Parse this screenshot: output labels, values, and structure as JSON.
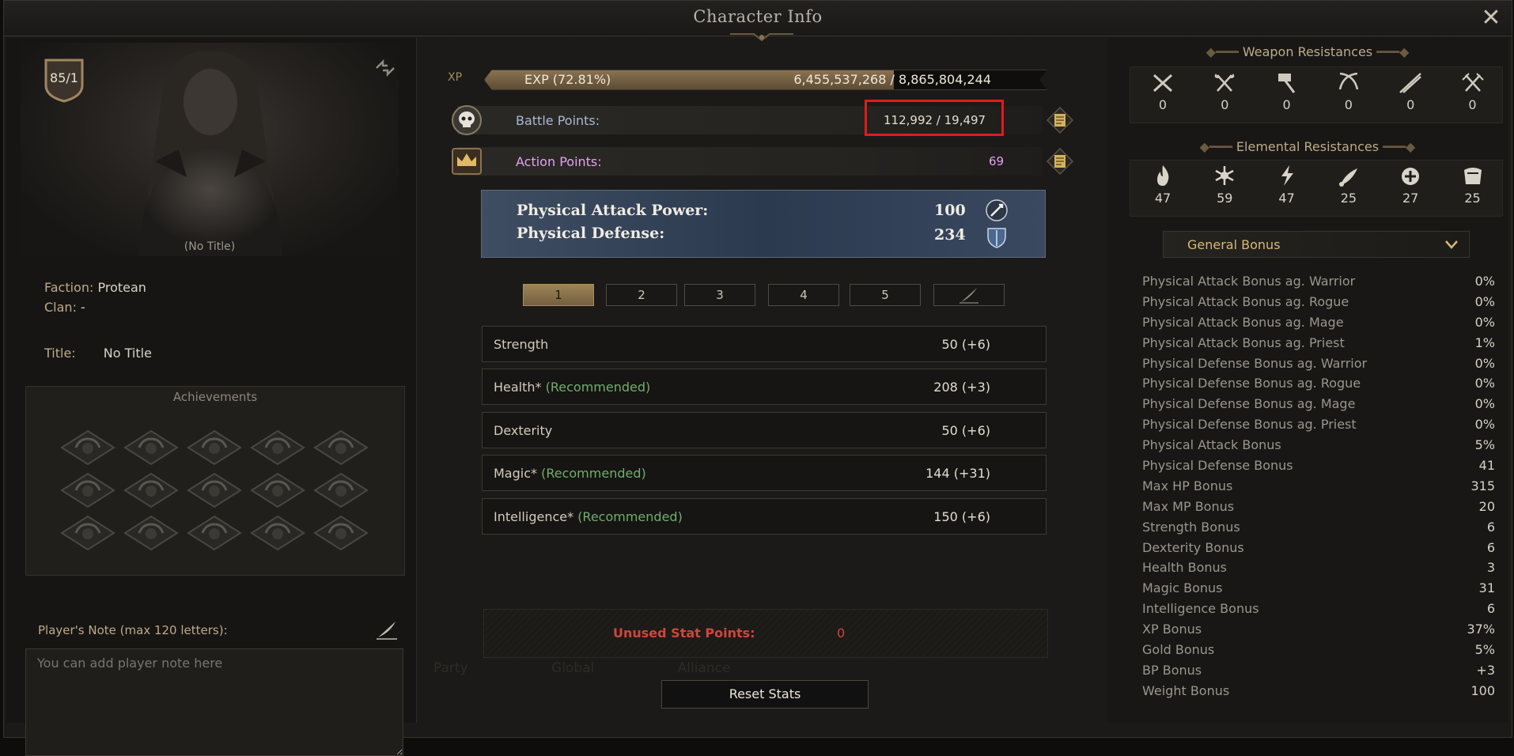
{
  "window": {
    "title": "Character Info",
    "close_label": "✕"
  },
  "character": {
    "level": "85/1",
    "portrait_caption": "(No Title)",
    "faction_label": "Faction:",
    "faction_value": "Protean",
    "clan_label": "Clan:",
    "clan_value": "-",
    "title_label": "Title:",
    "title_value": "No Title"
  },
  "achievements": {
    "title": "Achievements",
    "count": 15
  },
  "player_note": {
    "label": "Player's Note (max 120 letters):",
    "placeholder": "You can add player note here"
  },
  "xp": {
    "label": "XP",
    "text": "EXP (72.81%)",
    "value": "6,455,537,268 / 8,865,804,244",
    "percent": 72.81
  },
  "battle_points": {
    "label": "Battle Points:",
    "value": "112,992 / 19,497"
  },
  "action_points": {
    "label": "Action Points:",
    "value": "69"
  },
  "combat": {
    "attack_label": "Physical Attack Power:",
    "attack_value": "100",
    "defense_label": "Physical Defense:",
    "defense_value": "234"
  },
  "stat_tabs": [
    "1",
    "2",
    "3",
    "4",
    "5"
  ],
  "active_tab": "1",
  "stats": [
    {
      "name": "Strength",
      "recommended": "",
      "value": "50 (+6)"
    },
    {
      "name": "Health*",
      "recommended": "(Recommended)",
      "value": "208 (+3)"
    },
    {
      "name": "Dexterity",
      "recommended": "",
      "value": "50 (+6)"
    },
    {
      "name": "Magic*",
      "recommended": "(Recommended)",
      "value": "144 (+31)"
    },
    {
      "name": "Intelligence*",
      "recommended": "(Recommended)",
      "value": "150 (+6)"
    }
  ],
  "unused_points": {
    "label": "Unused Stat Points:",
    "value": "0"
  },
  "background_tabs": [
    "Party",
    "Global",
    "Alliance"
  ],
  "reset_button": "Reset Stats",
  "weapon_resistances": {
    "title": "Weapon Resistances",
    "items": [
      {
        "icon": "crossed-swords-icon",
        "value": "0"
      },
      {
        "icon": "crossed-axes-icon",
        "value": "0"
      },
      {
        "icon": "hammer-icon",
        "value": "0"
      },
      {
        "icon": "crossed-bows-icon",
        "value": "0"
      },
      {
        "icon": "crossed-spears-icon",
        "value": "0"
      },
      {
        "icon": "crossed-daggers-icon",
        "value": "0"
      }
    ]
  },
  "elemental_resistances": {
    "title": "Elemental Resistances",
    "items": [
      {
        "icon": "fire-icon",
        "value": "47"
      },
      {
        "icon": "ice-icon",
        "value": "59"
      },
      {
        "icon": "lightning-icon",
        "value": "47"
      },
      {
        "icon": "poison-icon",
        "value": "25"
      },
      {
        "icon": "dark-icon",
        "value": "27"
      },
      {
        "icon": "holy-icon",
        "value": "25"
      }
    ]
  },
  "bonus_dropdown": {
    "selected": "General Bonus"
  },
  "bonuses": [
    {
      "name": "Physical Attack Bonus ag. Warrior",
      "value": "0%"
    },
    {
      "name": "Physical Attack Bonus ag. Rogue",
      "value": "0%"
    },
    {
      "name": "Physical Attack Bonus ag. Mage",
      "value": "0%"
    },
    {
      "name": "Physical Attack Bonus ag. Priest",
      "value": "1%"
    },
    {
      "name": "Physical Defense Bonus ag. Warrior",
      "value": "0%"
    },
    {
      "name": "Physical Defense Bonus ag. Rogue",
      "value": "0%"
    },
    {
      "name": "Physical Defense Bonus ag. Mage",
      "value": "0%"
    },
    {
      "name": "Physical Defense Bonus ag. Priest",
      "value": "0%"
    },
    {
      "name": "Physical Attack Bonus",
      "value": "5%"
    },
    {
      "name": "Physical Defense Bonus",
      "value": "41"
    },
    {
      "name": "Max HP Bonus",
      "value": "315"
    },
    {
      "name": "Max MP Bonus",
      "value": "20"
    },
    {
      "name": "Strength Bonus",
      "value": "6"
    },
    {
      "name": "Dexterity Bonus",
      "value": "6"
    },
    {
      "name": "Health Bonus",
      "value": "3"
    },
    {
      "name": "Magic Bonus",
      "value": "31"
    },
    {
      "name": "Intelligence Bonus",
      "value": "6"
    },
    {
      "name": "XP Bonus",
      "value": "37%"
    },
    {
      "name": "Gold Bonus",
      "value": "5%"
    },
    {
      "name": "BP Bonus",
      "value": "+3"
    },
    {
      "name": "Weight Bonus",
      "value": "100"
    }
  ]
}
